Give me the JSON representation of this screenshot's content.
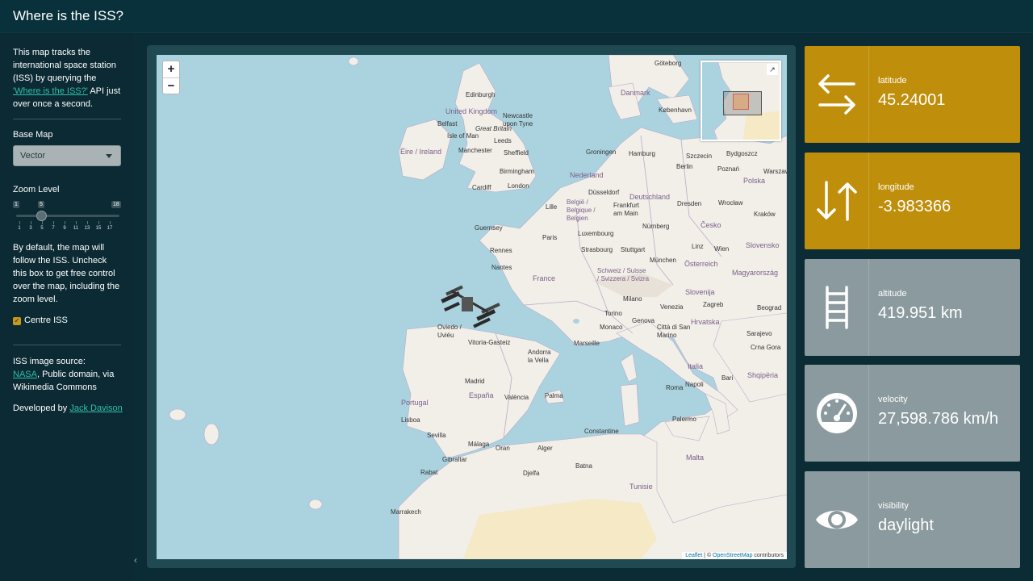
{
  "app": {
    "title": "Where is the ISS?"
  },
  "sidebar": {
    "intro_text": "This map tracks the international space station (ISS) by querying the",
    "intro_link": "'Where is the ISS?'",
    "intro_suffix": "API just over once a second.",
    "base_map_label": "Base Map",
    "base_map_value": "Vector",
    "zoom_label": "Zoom Level",
    "zoom": {
      "min": "1",
      "max": "18",
      "value": "5",
      "ticks": [
        "1",
        "3",
        "5",
        "7",
        "9",
        "11",
        "13",
        "15",
        "17"
      ]
    },
    "follow_text": "By default, the map will follow the ISS. Uncheck this box to get free control over the map, including the zoom level.",
    "centre_label": "Centre ISS",
    "centre_checked": true,
    "source_title": "ISS image source:",
    "source_link": "NASA",
    "source_text": ", Public domain, via Wikimedia Commons",
    "dev_text": "Developed by",
    "dev_link": "Jack Davison"
  },
  "map": {
    "zoom_in": "+",
    "zoom_out": "−",
    "attribution_leaflet": "Leaflet",
    "attribution_sep": " | © ",
    "attribution_osm": "OpenStreetMap",
    "attribution_suffix": " contributors",
    "labels": [
      "Göteborg",
      "Danmark",
      "København",
      "Edinburgh",
      "United Kingdom",
      "Belfast",
      "Newcastle upon Tyne",
      "Great Britain",
      "Isle of Man",
      "Leeds",
      "Éire / Ireland",
      "Manchester",
      "Sheffield",
      "Birmingham",
      "Cardiff",
      "London",
      "Nederland",
      "Groningen",
      "Hamburg",
      "Szczecin",
      "Bydgoszcz",
      "Berlin",
      "Poznań",
      "Warszaw",
      "Düsseldorf",
      "Deutschland",
      "Dresden",
      "Polska",
      "Wrocław",
      "Lille",
      "België / Belgique / Belgien",
      "Frankfurt am Main",
      "Česko",
      "Kraków",
      "Guernsey",
      "Paris",
      "Luxembourg",
      "Nürnberg",
      "Rennes",
      "Strasbourg",
      "Stuttgart",
      "Linz",
      "Wien",
      "Slovensko",
      "Nantes",
      "München",
      "Österreich",
      "France",
      "Schweiz / Suisse / Svizzera / Svizra",
      "Magyarország",
      "Slovenija",
      "Milano",
      "Torino",
      "Venezia",
      "Zagreb",
      "Oviedo / Uviéu",
      "Genova",
      "Hrvatska",
      "Beograd",
      "Monaco",
      "Città di San Marino",
      "Vitoria-Gasteiz",
      "Marseille",
      "Andorra la Vella",
      "Italia",
      "Sarajevo",
      "Crna Gora",
      "Madrid",
      "Portugal",
      "España",
      "València",
      "Palma",
      "Roma",
      "Bari",
      "Shqipëria",
      "Lisboa",
      "Napoli",
      "Sevilla",
      "Palermo",
      "Málaga",
      "Constantine",
      "Oran",
      "Alger",
      "Malta",
      "Gibraltar",
      "Batna",
      "Rabat",
      "Djelfa",
      "Marrakech",
      "Tunisie"
    ]
  },
  "value_boxes": [
    {
      "title": "latitude",
      "value": "45.24001",
      "icon": "arrows-left-right-icon",
      "color": "#bf8e0b"
    },
    {
      "title": "longitude",
      "value": "-3.983366",
      "icon": "arrows-up-down-icon",
      "color": "#bf8e0b"
    },
    {
      "title": "altitude",
      "value": "419.951 km",
      "icon": "ladder-icon",
      "color": "#8b9a9e"
    },
    {
      "title": "velocity",
      "value": "27,598.786 km/h",
      "icon": "speedometer-icon",
      "color": "#8b9a9e"
    },
    {
      "title": "visibility",
      "value": "daylight",
      "icon": "eye-icon",
      "color": "#8b9a9e"
    }
  ]
}
